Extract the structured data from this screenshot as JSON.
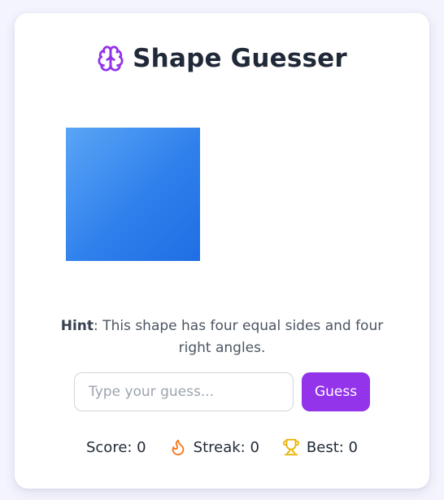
{
  "app": {
    "title": "Shape Guesser",
    "accent_color": "#9333ea"
  },
  "shape": {
    "name_hidden": true,
    "colors": [
      "#5aa5f6",
      "#1f6ee4"
    ]
  },
  "hint": {
    "label": "Hint",
    "text": ": This shape has four equal sides and four right angles."
  },
  "guess": {
    "placeholder": "Type your guess...",
    "value": "",
    "button_label": "Guess"
  },
  "stats": {
    "score_text": "Score: 0",
    "streak_text": "Streak: 0",
    "best_text": "Best: 0",
    "score": 0,
    "streak": 0,
    "best": 0,
    "streak_icon": "flame-icon",
    "best_icon": "trophy-icon"
  },
  "icons": {
    "header_icon": "brain-icon"
  }
}
